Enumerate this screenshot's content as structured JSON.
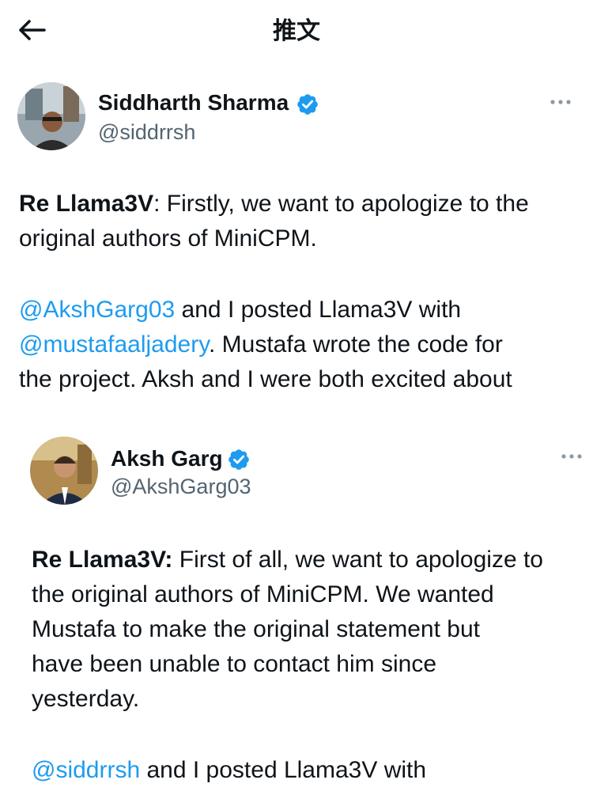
{
  "header": {
    "title": "推文"
  },
  "tweets": [
    {
      "author": {
        "name": "Siddharth Sharma",
        "handle": "@siddrrsh"
      },
      "lines": {
        "l1_bold": "Re Llama3V",
        "l1_rest": ": Firstly, we want to apologize to the",
        "l2": "original authors of MiniCPM.",
        "l3_mention": "@AkshGarg03",
        "l3_rest": " and I posted Llama3V with",
        "l4_mention": "@mustafaaljadery",
        "l4_rest": ". Mustafa wrote the code for",
        "l5": "the project. Aksh and I were both excited about"
      }
    },
    {
      "author": {
        "name": "Aksh Garg",
        "handle": "@AkshGarg03"
      },
      "lines": {
        "l1_bold": "Re Llama3V:",
        "l1_rest": " First of all, we want to apologize to",
        "l2": "the original authors of MiniCPM. We wanted",
        "l3": "Mustafa to make the original statement but",
        "l4": "have been unable to contact him since",
        "l5": "yesterday.",
        "l6_mention": "@siddrrsh",
        "l6_rest": " and I posted Llama3V with"
      }
    }
  ],
  "colors": {
    "accent": "#1d9bf0",
    "secondary_text": "#536471",
    "text": "#0f1419"
  },
  "icons": {
    "back": "arrow-left-icon",
    "verified": "verified-badge-icon",
    "more": "more-horizontal-icon"
  }
}
